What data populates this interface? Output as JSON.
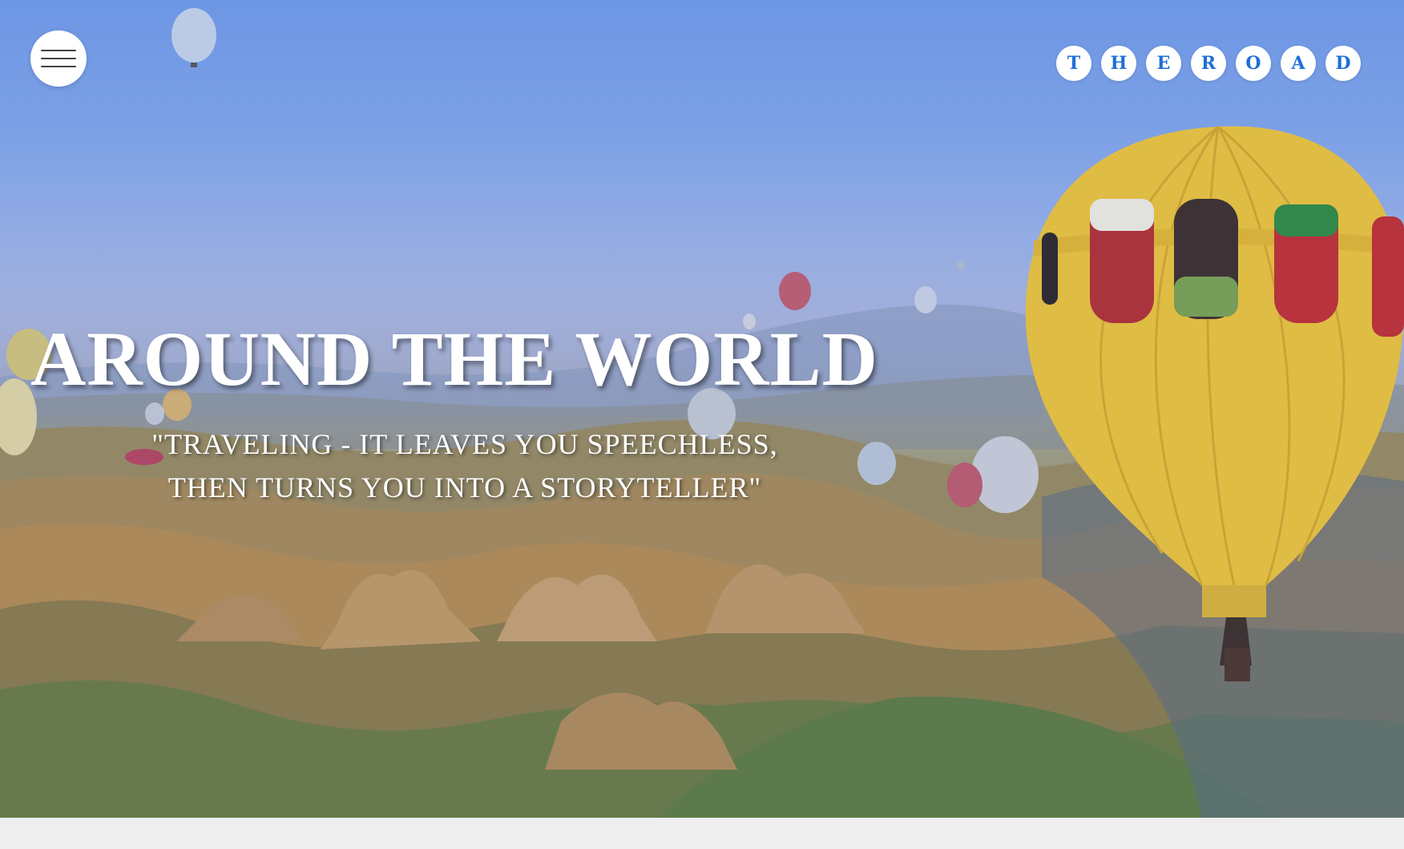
{
  "menu": {
    "icon": "hamburger-menu-icon"
  },
  "brand": {
    "letters": [
      "T",
      "H",
      "E",
      "R",
      "O",
      "A",
      "D"
    ],
    "color": "#1f6fd6"
  },
  "hero": {
    "title": "AROUND THE WORLD",
    "quote_line1": "\"TRAVELING - IT LEAVES YOU SPEECHLESS,",
    "quote_line2": "THEN TURNS YOU INTO A STORYTELLER\"",
    "image": "hot-air-balloons-over-valley"
  },
  "colors": {
    "sky_top": "#6f9ae8",
    "balloon_yellow": "#f2c531",
    "footer_bg": "#eeeeee"
  }
}
